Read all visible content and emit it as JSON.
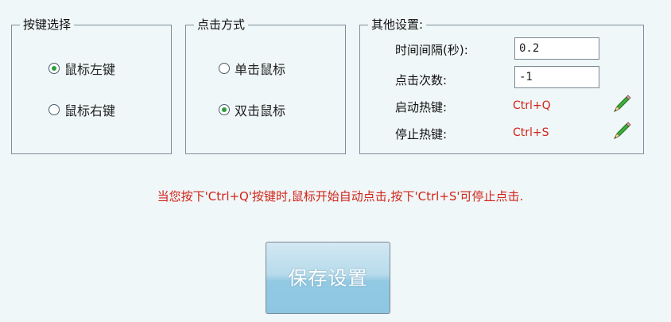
{
  "key_group": {
    "title": "按键选择",
    "options": [
      {
        "label": "鼠标左键",
        "checked": true
      },
      {
        "label": "鼠标右键",
        "checked": false
      }
    ]
  },
  "click_group": {
    "title": "点击方式",
    "options": [
      {
        "label": "单击鼠标",
        "checked": false
      },
      {
        "label": "双击鼠标",
        "checked": true
      }
    ]
  },
  "other_group": {
    "title": "其他设置:",
    "interval_label": "时间间隔(秒):",
    "interval_value": "0.2",
    "count_label": "点击次数:",
    "count_value": "-1",
    "start_label": "启动热键:",
    "start_hotkey": "Ctrl+Q",
    "stop_label": "停止热键:",
    "stop_hotkey": "Ctrl+S"
  },
  "hint": "当您按下'Ctrl+Q'按键时,鼠标开始自动点击,按下'Ctrl+S'可停止点击.",
  "save_label": "保存设置",
  "colors": {
    "background": "#f0f7f8",
    "hotkey_red": "#d2241a",
    "radio_dot_green": "#2e9d3e",
    "button_blue": "#92c9e3"
  },
  "icons": {
    "edit": "pencil-icon"
  }
}
